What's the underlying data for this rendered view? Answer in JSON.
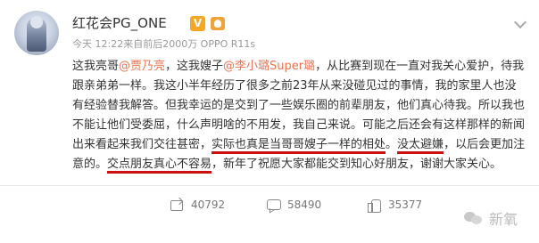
{
  "header": {
    "username": "红花会PG_ONE",
    "verified_badge": "V",
    "meta": "今天 12:22来自前后2000万 OPPO R11s"
  },
  "post": {
    "t1": "这我亮哥",
    "m1": "@贾乃亮",
    "t2": "，这我嫂子",
    "m2": "@李小璐Super璐",
    "t3": "，从比赛到现在一直对我关心爱护，待我跟亲弟弟一样。我这小半年经历了很多之前23年从来没碰见过的事情，我的家里人也没有经验替我解答。但我幸运的是交到了一些娱乐圈的前辈朋友，他们真心待我。所以我也不能让他们受委屈，什么声明啥的不用发，我自己来说。可能之后还会有这样那样的新闻出来看起来我们交往甚密，",
    "u1": "实际也真是当哥哥嫂子一样的相处",
    "t4": "。",
    "u2": "没太避嫌",
    "t5": "，以后会更加注意的。",
    "u3": "交点朋友真心不容易",
    "t6": "，新年了祝愿大家都能交到知心好朋友，谢谢大家关心。"
  },
  "actions": {
    "share_count": "40792",
    "comment_count": "58490",
    "like_count": "35377"
  },
  "watermark": "新氧",
  "icons": [
    "vip-verified-icon",
    "level-badge-icon",
    "chevron-down-icon",
    "share-icon",
    "comment-icon",
    "like-icon",
    "wechat-icon"
  ],
  "colors": {
    "mention": "#eb7350",
    "underline": "#cc1111",
    "vip": "#f5a623"
  }
}
